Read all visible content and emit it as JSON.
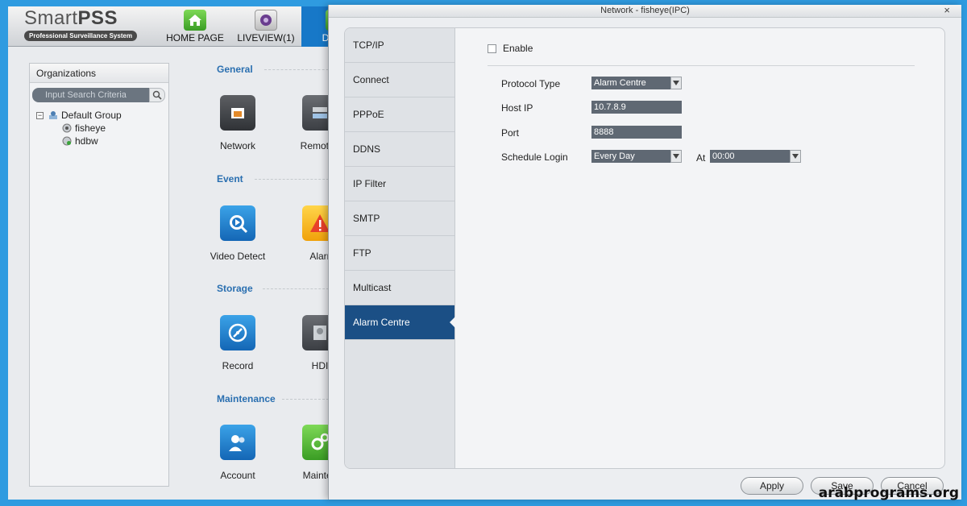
{
  "app": {
    "logo_title_a": "Smart",
    "logo_title_b": "PSS",
    "logo_subtitle": "Professional Surveillance System",
    "nav": [
      {
        "label": "HOME PAGE"
      },
      {
        "label": "LIVEVIEW(1)"
      },
      {
        "label": "DEVIC"
      }
    ]
  },
  "organizations": {
    "title": "Organizations",
    "search_placeholder": "Input Search Criteria",
    "tree": {
      "toggle": "−",
      "group": "Default Group",
      "children": [
        {
          "label": "fisheye"
        },
        {
          "label": "hdbw"
        }
      ]
    }
  },
  "config": {
    "sections": [
      {
        "title": "General",
        "tiles": [
          {
            "label": "Network"
          },
          {
            "label": "Remote I"
          }
        ]
      },
      {
        "title": "Event",
        "tiles": [
          {
            "label": "Video Detect"
          },
          {
            "label": "Alarr"
          }
        ]
      },
      {
        "title": "Storage",
        "tiles": [
          {
            "label": "Record"
          },
          {
            "label": "HDI"
          }
        ]
      },
      {
        "title": "Maintenance",
        "tiles": [
          {
            "label": "Account"
          },
          {
            "label": "Mainten"
          }
        ]
      }
    ]
  },
  "dialog": {
    "title": "Network - fisheye(IPC)",
    "close": "×",
    "menu": [
      {
        "label": "TCP/IP"
      },
      {
        "label": "Connect"
      },
      {
        "label": "PPPoE"
      },
      {
        "label": "DDNS"
      },
      {
        "label": "IP Filter"
      },
      {
        "label": "SMTP"
      },
      {
        "label": "FTP"
      },
      {
        "label": "Multicast"
      },
      {
        "label": "Alarm Centre"
      }
    ],
    "active_menu": "Alarm Centre",
    "enable_label": "Enable",
    "enable_checked": false,
    "form": {
      "protocol_type_label": "Protocol Type",
      "protocol_type_value": "Alarm Centre",
      "host_ip_label": "Host IP",
      "host_ip_value": "10.7.8.9",
      "port_label": "Port",
      "port_value": "8888",
      "schedule_login_label": "Schedule Login",
      "schedule_login_value": "Every Day",
      "at_label": "At",
      "at_value": "00:00"
    },
    "buttons": {
      "apply": "Apply",
      "save": "Save",
      "cancel": "Cancel"
    }
  },
  "watermark": "arabprograms.org",
  "colors": {
    "frame": "#2f9be0",
    "active_tab": "#1778c8",
    "active_menu": "#1b4f85",
    "field": "#5f6873",
    "section_title": "#2a6fb0"
  }
}
